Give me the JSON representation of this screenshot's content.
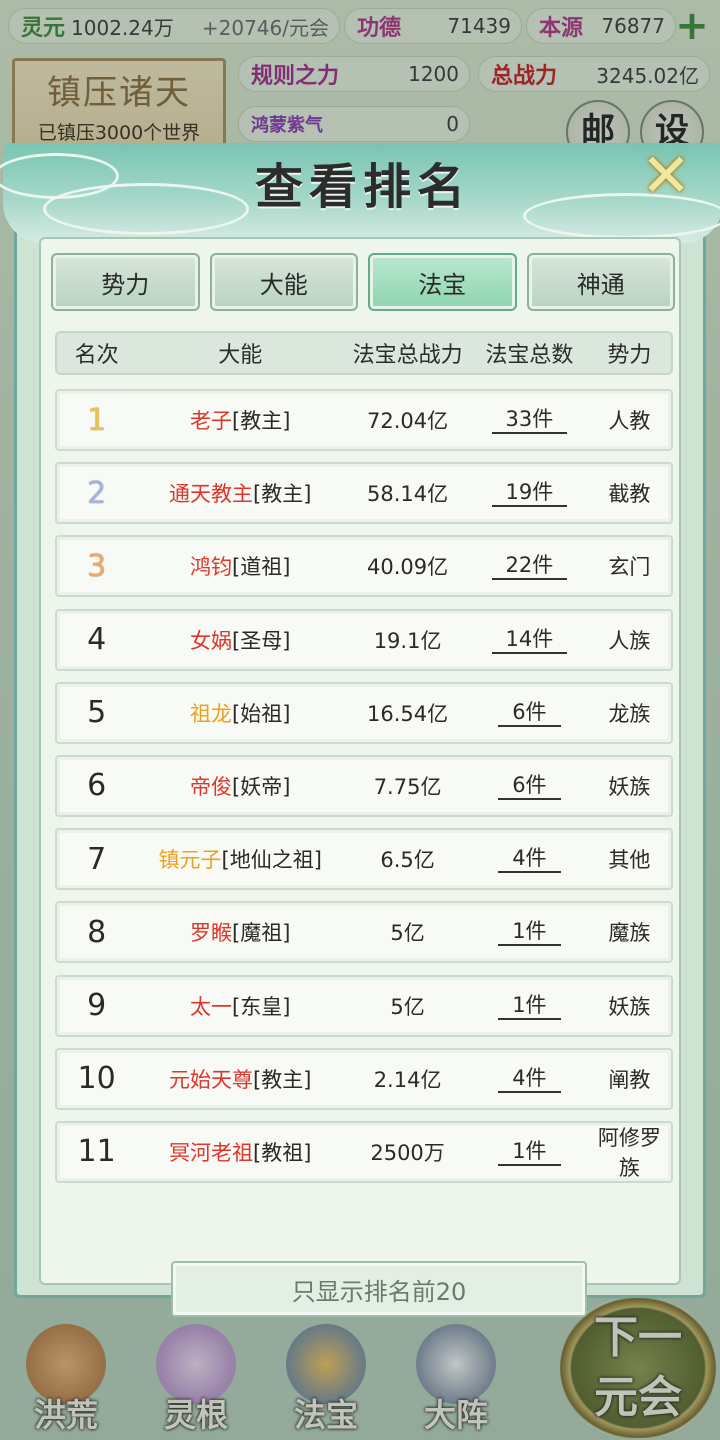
{
  "top_stats": {
    "lingyuan_label": "灵元",
    "lingyuan_value": "1002.24万",
    "lingyuan_rate": "+20746/元会",
    "gongde_label": "功德",
    "gongde_value": "71439",
    "benyuan_label": "本源",
    "benyuan_value": "76877",
    "plus_symbol": "+",
    "guize_label": "规则之力",
    "guize_value": "1200",
    "zongzhan_label": "总战力",
    "zongzhan_value": "3245.02亿",
    "hongmeng_label": "鸿蒙紫气",
    "hongmeng_value": "0"
  },
  "banner": {
    "title": "镇压诸天",
    "subtitle": "已镇压3000个世界"
  },
  "side_buttons": {
    "mail": "邮",
    "settings": "设"
  },
  "modal": {
    "title": "查看排名",
    "close_symbol": "✕",
    "tabs": [
      "势力",
      "大能",
      "法宝",
      "神通"
    ],
    "active_tab": "法宝",
    "headers": {
      "rank": "名次",
      "name": "大能",
      "power": "法宝总战力",
      "count": "法宝总数",
      "faction": "势力"
    },
    "rows": [
      {
        "rank": "1",
        "name": "老子",
        "title": "[教主]",
        "power": "72.04亿",
        "count": "33件",
        "faction": "人教",
        "name_color": "#e0352b"
      },
      {
        "rank": "2",
        "name": "通天教主",
        "title": "[教主]",
        "power": "58.14亿",
        "count": "19件",
        "faction": "截教",
        "name_color": "#e0352b"
      },
      {
        "rank": "3",
        "name": "鸿钧",
        "title": "[道祖]",
        "power": "40.09亿",
        "count": "22件",
        "faction": "玄门",
        "name_color": "#e0352b"
      },
      {
        "rank": "4",
        "name": "女娲",
        "title": "[圣母]",
        "power": "19.1亿",
        "count": "14件",
        "faction": "人族",
        "name_color": "#e0352b"
      },
      {
        "rank": "5",
        "name": "祖龙",
        "title": "[始祖]",
        "power": "16.54亿",
        "count": "6件",
        "faction": "龙族",
        "name_color": "#f0a01c"
      },
      {
        "rank": "6",
        "name": "帝俊",
        "title": "[妖帝]",
        "power": "7.75亿",
        "count": "6件",
        "faction": "妖族",
        "name_color": "#e0352b"
      },
      {
        "rank": "7",
        "name": "镇元子",
        "title": "[地仙之祖]",
        "power": "6.5亿",
        "count": "4件",
        "faction": "其他",
        "name_color": "#f0a01c"
      },
      {
        "rank": "8",
        "name": "罗睺",
        "title": "[魔祖]",
        "power": "5亿",
        "count": "1件",
        "faction": "魔族",
        "name_color": "#e0352b"
      },
      {
        "rank": "9",
        "name": "太一",
        "title": "[东皇]",
        "power": "5亿",
        "count": "1件",
        "faction": "妖族",
        "name_color": "#e0352b"
      },
      {
        "rank": "10",
        "name": "元始天尊",
        "title": "[教主]",
        "power": "2.14亿",
        "count": "4件",
        "faction": "阐教",
        "name_color": "#e0352b"
      },
      {
        "rank": "11",
        "name": "冥河老祖",
        "title": "[教祖]",
        "power": "2500万",
        "count": "1件",
        "faction": "阿修罗族",
        "name_color": "#e0352b"
      }
    ],
    "show_top_button": "只显示排名前20"
  },
  "bottom_nav": [
    "洪荒",
    "灵根",
    "法宝",
    "大阵"
  ],
  "next_button": {
    "line1": "下一",
    "line2": "元会"
  },
  "colors": {
    "accent": "#6fa79a",
    "header": "#78c4b2",
    "name_red": "#e0352b",
    "name_orange": "#f0a01c",
    "rank_gold": "#e8c24a",
    "rank_silver": "#a7b4d8",
    "rank_bronze": "#f0a86a"
  }
}
